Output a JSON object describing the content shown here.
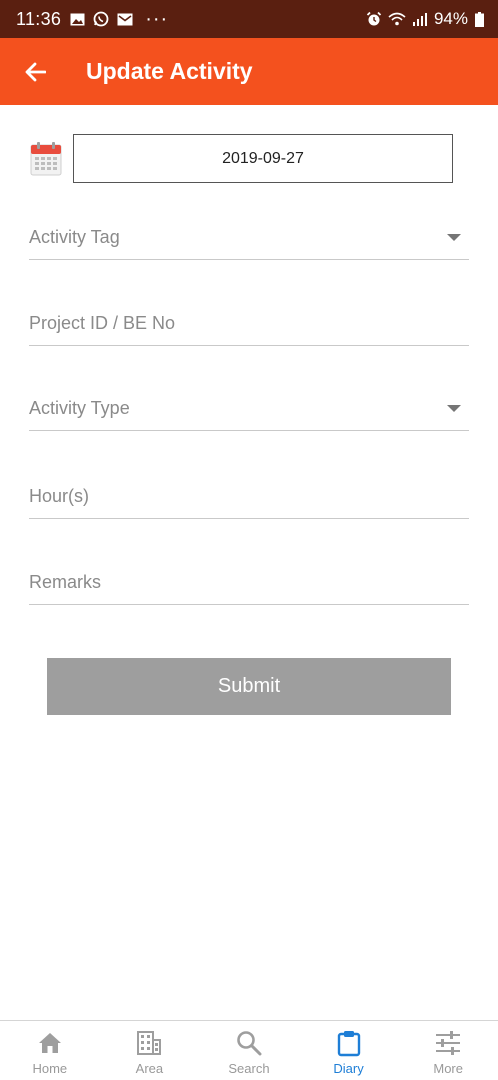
{
  "status_bar": {
    "time": "11:36",
    "battery": "94%",
    "more_dots": "···"
  },
  "app_bar": {
    "title": "Update Activity",
    "back_icon": "arrow-left-icon"
  },
  "date": {
    "value": "2019-09-27",
    "icon": "calendar-icon"
  },
  "form": {
    "activity_tag": {
      "label": "Activity Tag"
    },
    "project_id": {
      "placeholder": "Project ID / BE No"
    },
    "activity_type": {
      "label": "Activity Type"
    },
    "hours": {
      "placeholder": "Hour(s)"
    },
    "remarks": {
      "placeholder": "Remarks"
    },
    "submit_label": "Submit"
  },
  "bottom_nav": {
    "items": [
      {
        "label": "Home",
        "icon": "home-icon"
      },
      {
        "label": "Area",
        "icon": "building-icon"
      },
      {
        "label": "Search",
        "icon": "search-icon"
      },
      {
        "label": "Diary",
        "icon": "clipboard-icon"
      },
      {
        "label": "More",
        "icon": "sliders-icon"
      }
    ],
    "active_index": 3
  },
  "colors": {
    "status_bar": "#5a1f10",
    "app_bar": "#f4511e",
    "submit_disabled": "#9e9e9e",
    "nav_active": "#1e7ed6",
    "nav_inactive": "#999999"
  }
}
